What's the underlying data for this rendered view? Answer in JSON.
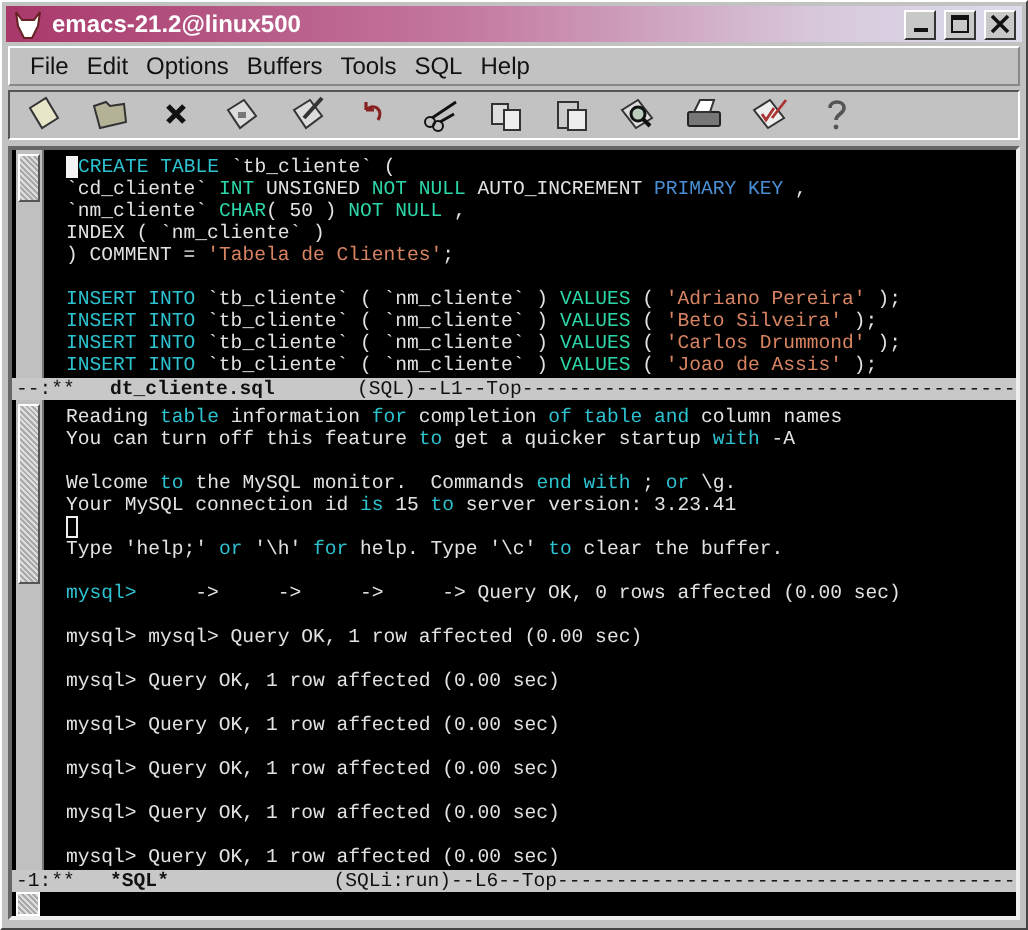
{
  "window": {
    "title": "emacs-21.2@linux500"
  },
  "menu": [
    "File",
    "Edit",
    "Options",
    "Buffers",
    "Tools",
    "SQL",
    "Help"
  ],
  "panes": [
    {
      "lines": [
        {
          "kind": "text",
          "segments": [
            {
              "kind": "cursor",
              "filled": true
            },
            {
              "kind": "keyword",
              "text": "CREATE TABLE"
            },
            {
              "kind": "plain",
              "text": " `tb_cliente` ("
            }
          ]
        },
        {
          "kind": "text",
          "segments": [
            {
              "kind": "plain",
              "text": "`cd_cliente` "
            },
            {
              "kind": "type",
              "text": "INT"
            },
            {
              "kind": "plain",
              "text": " UNSIGNED "
            },
            {
              "kind": "type",
              "text": "NOT NULL"
            },
            {
              "kind": "plain",
              "text": " AUTO_INCREMENT "
            },
            {
              "kind": "builtin",
              "text": "PRIMARY KEY"
            },
            {
              "kind": "plain",
              "text": " ,"
            }
          ]
        },
        {
          "kind": "text",
          "segments": [
            {
              "kind": "plain",
              "text": "`nm_cliente` "
            },
            {
              "kind": "type",
              "text": "CHAR"
            },
            {
              "kind": "plain",
              "text": "( 50 ) "
            },
            {
              "kind": "type",
              "text": "NOT NULL"
            },
            {
              "kind": "plain",
              "text": " ,"
            }
          ]
        },
        {
          "kind": "text",
          "segments": [
            {
              "kind": "plain",
              "text": "INDEX ( `nm_cliente` )"
            }
          ]
        },
        {
          "kind": "text",
          "segments": [
            {
              "kind": "plain",
              "text": ") COMMENT = "
            },
            {
              "kind": "string",
              "text": "'Tabela de Clientes'"
            },
            {
              "kind": "plain",
              "text": ";"
            }
          ]
        },
        {
          "kind": "blank"
        },
        {
          "kind": "text",
          "segments": [
            {
              "kind": "keyword",
              "text": "INSERT INTO"
            },
            {
              "kind": "plain",
              "text": " `tb_cliente` ( `nm_cliente` ) "
            },
            {
              "kind": "type",
              "text": "VALUES"
            },
            {
              "kind": "plain",
              "text": " ( "
            },
            {
              "kind": "string",
              "text": "'Adriano Pereira'"
            },
            {
              "kind": "plain",
              "text": " );"
            }
          ]
        },
        {
          "kind": "text",
          "segments": [
            {
              "kind": "keyword",
              "text": "INSERT INTO"
            },
            {
              "kind": "plain",
              "text": " `tb_cliente` ( `nm_cliente` ) "
            },
            {
              "kind": "type",
              "text": "VALUES"
            },
            {
              "kind": "plain",
              "text": " ( "
            },
            {
              "kind": "string",
              "text": "'Beto Silveira'"
            },
            {
              "kind": "plain",
              "text": " );"
            }
          ]
        },
        {
          "kind": "text",
          "segments": [
            {
              "kind": "keyword",
              "text": "INSERT INTO"
            },
            {
              "kind": "plain",
              "text": " `tb_cliente` ( `nm_cliente` ) "
            },
            {
              "kind": "type",
              "text": "VALUES"
            },
            {
              "kind": "plain",
              "text": " ( "
            },
            {
              "kind": "string",
              "text": "'Carlos Drummond'"
            },
            {
              "kind": "plain",
              "text": " );"
            }
          ]
        },
        {
          "kind": "text",
          "segments": [
            {
              "kind": "keyword",
              "text": "INSERT INTO"
            },
            {
              "kind": "plain",
              "text": " `tb_cliente` ( `nm_cliente` ) "
            },
            {
              "kind": "type",
              "text": "VALUES"
            },
            {
              "kind": "plain",
              "text": " ( "
            },
            {
              "kind": "string",
              "text": "'Joao de Assis'"
            },
            {
              "kind": "plain",
              "text": " );"
            }
          ]
        }
      ],
      "mode_line": {
        "status": "--:**",
        "buffer": "dt_cliente.sql",
        "info": "(SQL)--L1--Top------------------------------------------"
      }
    },
    {
      "lines": [
        {
          "kind": "text",
          "segments": [
            {
              "kind": "plain",
              "text": "Reading "
            },
            {
              "kind": "keyword",
              "text": "table"
            },
            {
              "kind": "plain",
              "text": " information "
            },
            {
              "kind": "keyword",
              "text": "for"
            },
            {
              "kind": "plain",
              "text": " completion "
            },
            {
              "kind": "keyword",
              "text": "of table and"
            },
            {
              "kind": "plain",
              "text": " column names"
            }
          ]
        },
        {
          "kind": "text",
          "segments": [
            {
              "kind": "plain",
              "text": "You can turn off this feature "
            },
            {
              "kind": "keyword",
              "text": "to"
            },
            {
              "kind": "plain",
              "text": " get a quicker startup "
            },
            {
              "kind": "keyword",
              "text": "with"
            },
            {
              "kind": "plain",
              "text": " -A"
            }
          ]
        },
        {
          "kind": "blank"
        },
        {
          "kind": "text",
          "segments": [
            {
              "kind": "plain",
              "text": "Welcome "
            },
            {
              "kind": "keyword",
              "text": "to"
            },
            {
              "kind": "plain",
              "text": " the MySQL monitor.  Commands "
            },
            {
              "kind": "keyword",
              "text": "end with"
            },
            {
              "kind": "plain",
              "text": " ; "
            },
            {
              "kind": "keyword",
              "text": "or"
            },
            {
              "kind": "plain",
              "text": " \\g."
            }
          ]
        },
        {
          "kind": "text",
          "segments": [
            {
              "kind": "plain",
              "text": "Your MySQL connection id "
            },
            {
              "kind": "keyword",
              "text": "is"
            },
            {
              "kind": "plain",
              "text": " 15 "
            },
            {
              "kind": "keyword",
              "text": "to"
            },
            {
              "kind": "plain",
              "text": " server version: 3.23.41"
            }
          ]
        },
        {
          "kind": "text",
          "segments": [
            {
              "kind": "cursor",
              "filled": false
            }
          ]
        },
        {
          "kind": "text",
          "segments": [
            {
              "kind": "plain",
              "text": "Type 'help;' "
            },
            {
              "kind": "keyword",
              "text": "or"
            },
            {
              "kind": "plain",
              "text": " '\\h' "
            },
            {
              "kind": "keyword",
              "text": "for"
            },
            {
              "kind": "plain",
              "text": " help. Type '\\c' "
            },
            {
              "kind": "keyword",
              "text": "to"
            },
            {
              "kind": "plain",
              "text": " clear the buffer."
            }
          ]
        },
        {
          "kind": "blank"
        },
        {
          "kind": "text",
          "segments": [
            {
              "kind": "prompt",
              "text": "mysql>"
            },
            {
              "kind": "plain",
              "text": "     ->     ->     ->     -> Query OK, 0 rows affected (0.00 sec)"
            }
          ]
        },
        {
          "kind": "blank"
        },
        {
          "kind": "text",
          "segments": [
            {
              "kind": "plain",
              "text": "mysql> mysql> Query OK, 1 row affected (0.00 sec)"
            }
          ]
        },
        {
          "kind": "blank"
        },
        {
          "kind": "text",
          "segments": [
            {
              "kind": "plain",
              "text": "mysql> Query OK, 1 row affected (0.00 sec)"
            }
          ]
        },
        {
          "kind": "blank"
        },
        {
          "kind": "text",
          "segments": [
            {
              "kind": "plain",
              "text": "mysql> Query OK, 1 row affected (0.00 sec)"
            }
          ]
        },
        {
          "kind": "blank"
        },
        {
          "kind": "text",
          "segments": [
            {
              "kind": "plain",
              "text": "mysql> Query OK, 1 row affected (0.00 sec)"
            }
          ]
        },
        {
          "kind": "blank"
        },
        {
          "kind": "text",
          "segments": [
            {
              "kind": "plain",
              "text": "mysql> Query OK, 1 row affected (0.00 sec)"
            }
          ]
        },
        {
          "kind": "blank"
        },
        {
          "kind": "text",
          "segments": [
            {
              "kind": "plain",
              "text": "mysql> Query OK, 1 row affected (0.00 sec)"
            }
          ]
        }
      ],
      "mode_line": {
        "status": "-1:**",
        "buffer": "*SQL*",
        "info": "(SQLi:run)--L6--Top---------------------------------------"
      }
    }
  ]
}
